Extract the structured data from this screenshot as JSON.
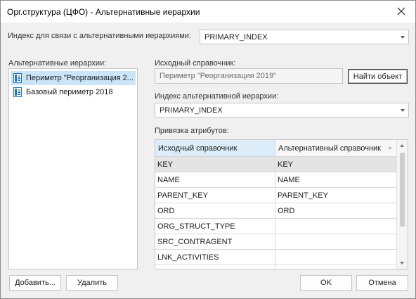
{
  "window": {
    "title": "Орг.структура (ЦФО) - Альтернативные иерархии"
  },
  "link_index": {
    "label": "Индекс для связи с альтернативными иерархиями:",
    "value": "PRIMARY_INDEX"
  },
  "alt_hierarchies": {
    "label": "Альтернативные иерархии:",
    "items": [
      {
        "label": "Периметр \"Реорганизация 2...",
        "selected": true
      },
      {
        "label": "Базовый периметр 2018",
        "selected": false
      }
    ],
    "add_label": "Добавить...",
    "delete_label": "Удалить"
  },
  "source_directory": {
    "label": "Исходный справочник:",
    "value": "Периметр \"Реорганизация 2019\"",
    "find_label": "Найти объект"
  },
  "alt_index": {
    "label": "Индекс альтернативной иерархии:",
    "value": "PRIMARY_INDEX"
  },
  "attribute_binding": {
    "label": "Привязка атрибутов:",
    "columns": [
      "Исходный справочник",
      "Альтернативный справочник"
    ],
    "rows": [
      [
        "KEY",
        "KEY"
      ],
      [
        "NAME",
        "NAME"
      ],
      [
        "PARENT_KEY",
        "PARENT_KEY"
      ],
      [
        "ORD",
        "ORD"
      ],
      [
        "ORG_STRUCT_TYPE",
        ""
      ],
      [
        "SRC_CONTRAGENT",
        ""
      ],
      [
        "LNK_ACTIVITIES",
        ""
      ],
      [
        "",
        ""
      ]
    ]
  },
  "footer": {
    "ok_label": "OK",
    "cancel_label": "Отмена"
  },
  "colors": {
    "selection": "#cce4f7",
    "header_selected": "#dcecf8",
    "icon_blue": "#1e73c8"
  }
}
